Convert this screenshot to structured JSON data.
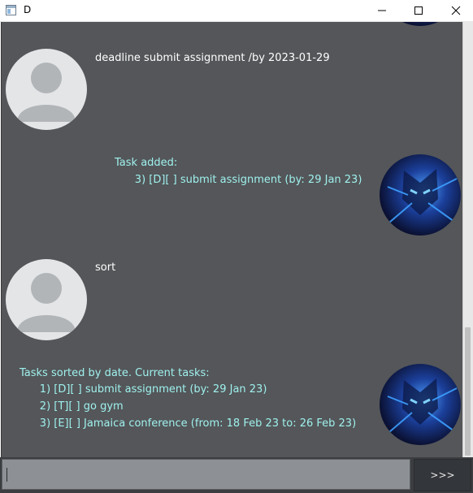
{
  "window": {
    "title": "D"
  },
  "dialogs": [
    {
      "role": "user",
      "text": "deadline submit assignment /by 2023-01-29"
    },
    {
      "role": "bot",
      "lines": [
        "Task added:",
        "      3) [D][ ] submit assignment (by: 29 Jan 23)"
      ]
    },
    {
      "role": "user",
      "text": "sort"
    },
    {
      "role": "bot",
      "lines": [
        "Tasks sorted by date. Current tasks:",
        "      1) [D][ ] submit assignment (by: 29 Jan 23)",
        "      2) [T][ ] go gym",
        "      3) [E][ ] Jamaica conference (from: 18 Feb 23 to: 26 Feb 23)"
      ]
    }
  ],
  "input": {
    "value": "",
    "send_label": ">>>"
  },
  "colors": {
    "background": "#545659",
    "user_text": "#ffffff",
    "bot_text": "#9ff1ee"
  }
}
